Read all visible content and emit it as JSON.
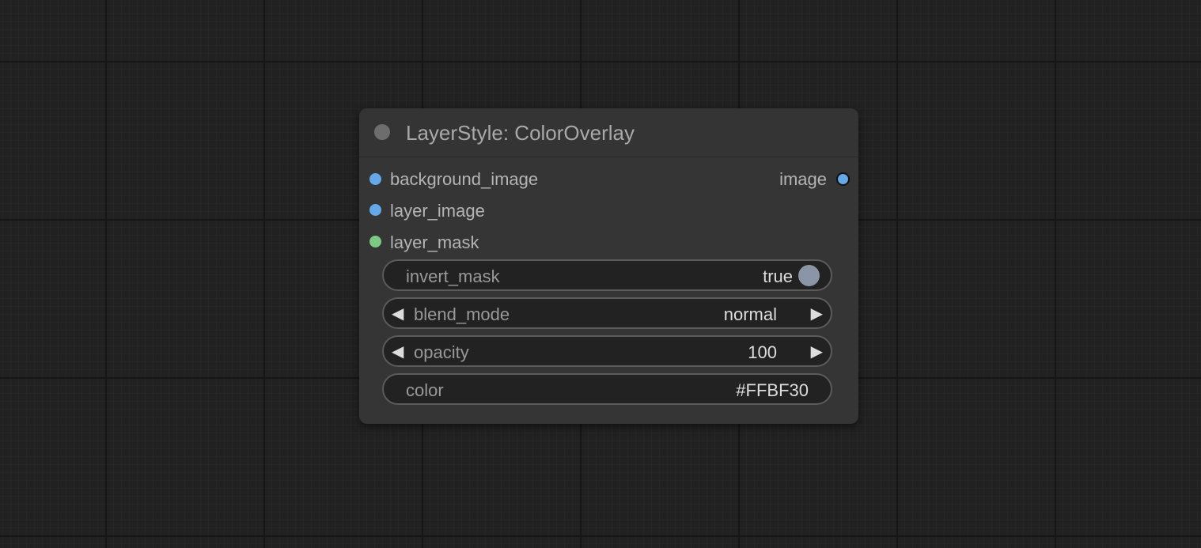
{
  "node": {
    "title": "LayerStyle: ColorOverlay",
    "inputs": [
      {
        "label": "background_image",
        "color": "#64a8e8"
      },
      {
        "label": "layer_image",
        "color": "#64a8e8"
      },
      {
        "label": "layer_mask",
        "color": "#7dc983"
      }
    ],
    "output": {
      "label": "image",
      "color": "#64a8e8"
    },
    "widgets": {
      "invert_mask": {
        "label": "invert_mask",
        "value": "true"
      },
      "blend_mode": {
        "label": "blend_mode",
        "value": "normal",
        "left_arrow": "◀",
        "right_arrow": "▶"
      },
      "opacity": {
        "label": "opacity",
        "value": "100",
        "left_arrow": "◀",
        "right_arrow": "▶"
      },
      "color": {
        "label": "color",
        "value": "#FFBF30"
      }
    }
  },
  "icons": {
    "collapse": "collapse-dot-icon",
    "slot": "slot-dot-icon",
    "toggle": "toggle-knob-icon",
    "arrow_left": "arrow-left-icon",
    "arrow_right": "arrow-right-icon"
  }
}
